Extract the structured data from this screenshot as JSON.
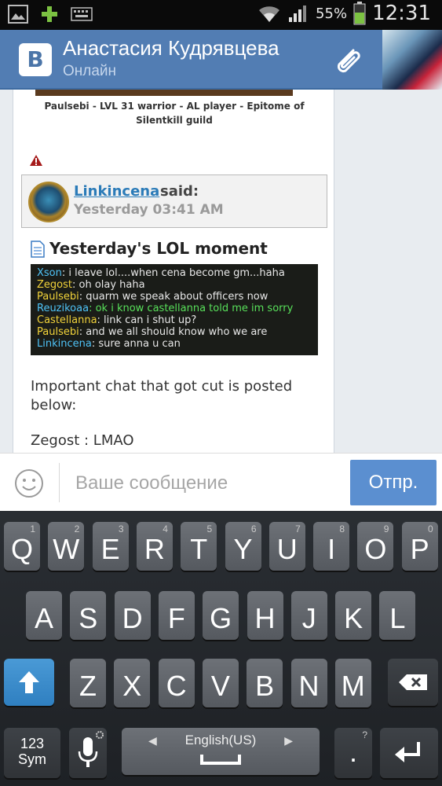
{
  "status_bar": {
    "battery_percent": "55%",
    "time": "12:31",
    "icons": [
      "gallery-icon",
      "plus-icon",
      "keyboard-icon",
      "wifi-icon",
      "signal-icon",
      "battery-icon"
    ]
  },
  "header": {
    "logo": "В",
    "contact_name": "Анастасия Кудрявцева",
    "contact_status": "Онлайн"
  },
  "post": {
    "caption_line1": "Paulsebi - LVL 31 warrior - AL player - Epitome of",
    "caption_line2": "Silentkill guild",
    "quote": {
      "author": "Linkincena",
      "said": "said:",
      "date": "Yesterday 03:41 AM"
    },
    "title": "Yesterday's LOL moment",
    "chat_lines": [
      {
        "name": "Xson",
        "text": ": i leave lol....when cena become gm...haha",
        "name_color": "#4fc3f7",
        "text_color": "#e8e8e8"
      },
      {
        "name": "Zegost",
        "text": ": oh olay haha",
        "name_color": "#f2d33a",
        "text_color": "#e8e8e8"
      },
      {
        "name": "Paulsebi",
        "text": ": quarm we speak about officers now",
        "name_color": "#f2d33a",
        "text_color": "#e8e8e8"
      },
      {
        "name": "Reuzikoaa",
        "text": ": ok i know castellanna told me im sorry",
        "name_color": "#4fc3f7",
        "text_color": "#58e05a"
      },
      {
        "name": "Castellanna",
        "text": ": link can i shut up?",
        "name_color": "#f2d33a",
        "text_color": "#e8e8e8"
      },
      {
        "name": "Paulsebi",
        "text": ": and we all should know who we are",
        "name_color": "#f2d33a",
        "text_color": "#e8e8e8"
      },
      {
        "name": "Linkincena",
        "text": ": sure anna u can",
        "name_color": "#4fc3f7",
        "text_color": "#e8e8e8"
      }
    ],
    "body_line1": "Important chat that got cut is posted below:",
    "body_line2": "Zegost : LMAO"
  },
  "composer": {
    "placeholder": "Ваше сообщение",
    "send_label": "Отпр."
  },
  "keyboard": {
    "row1": [
      {
        "key": "Q",
        "sub": "1"
      },
      {
        "key": "W",
        "sub": "2"
      },
      {
        "key": "E",
        "sub": "3"
      },
      {
        "key": "R",
        "sub": "4"
      },
      {
        "key": "T",
        "sub": "5"
      },
      {
        "key": "Y",
        "sub": "6"
      },
      {
        "key": "U",
        "sub": "7"
      },
      {
        "key": "I",
        "sub": "8"
      },
      {
        "key": "O",
        "sub": "9"
      },
      {
        "key": "P",
        "sub": "0"
      }
    ],
    "row2": [
      "A",
      "S",
      "D",
      "F",
      "G",
      "H",
      "J",
      "K",
      "L"
    ],
    "row3": [
      "Z",
      "X",
      "C",
      "V",
      "B",
      "N",
      "M"
    ],
    "sym_label_top": "123",
    "sym_label_bottom": "Sym",
    "space_label": "English(US)",
    "period_label": ".",
    "period_sub": "?"
  }
}
